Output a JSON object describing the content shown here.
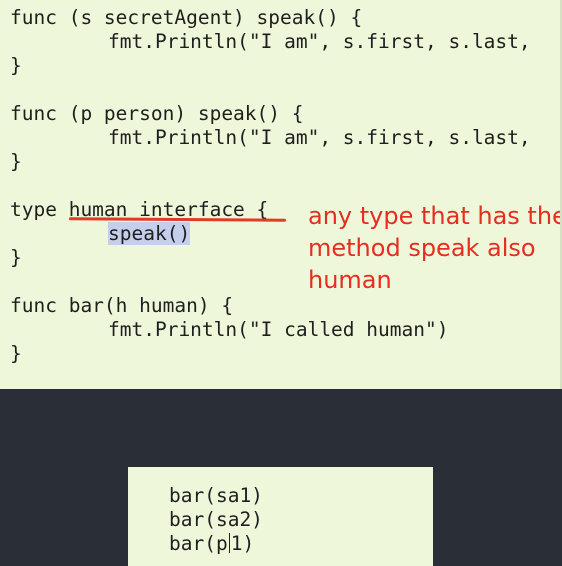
{
  "code_top": {
    "lines": [
      "func (s secretAgent) speak() {",
      "fmt.Println(\"I am\", s.first, s.last,",
      "}",
      "func (p person) speak() {",
      "fmt.Println(\"I am\", s.first, s.last,",
      "}",
      "type human interface {",
      "speak()",
      "}",
      "func bar(h human) {",
      "fmt.Println(\"I called human\")",
      "}"
    ]
  },
  "annotation": {
    "line1": "any type that has the",
    "line2": "method speak also",
    "line3": "human"
  },
  "code_bottom": {
    "line1": "bar(sa1)",
    "line2": "bar(sa2)",
    "line3_prefix": "bar(p",
    "line3_suffix": "1)"
  },
  "colors": {
    "editor_bg": "#eef7d9",
    "dark_bg": "#2a2e36",
    "annotation": "#e62d1f",
    "selection": "#c5cfec"
  }
}
